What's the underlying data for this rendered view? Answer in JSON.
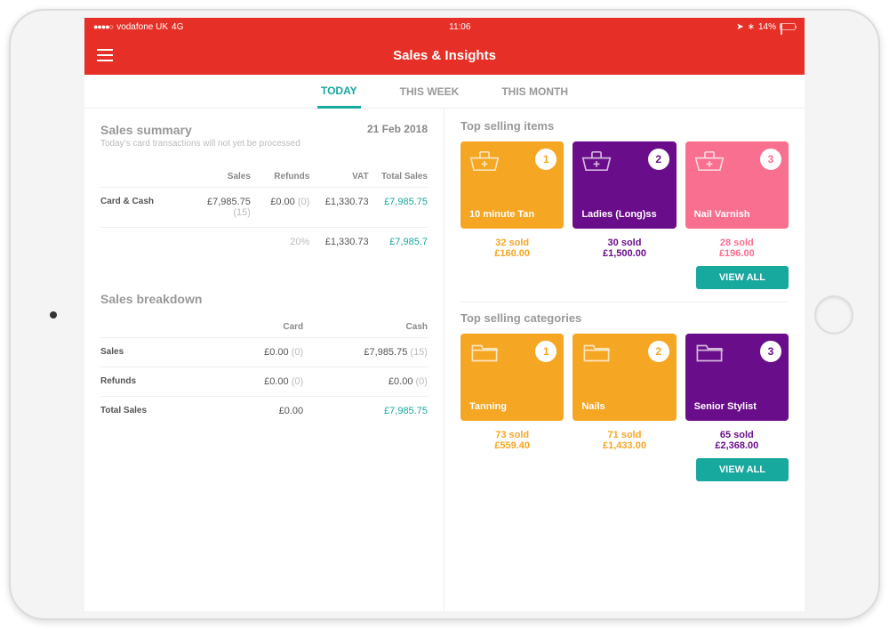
{
  "status": {
    "carrier": "vodafone UK",
    "network": "4G",
    "time": "11:06",
    "bluetooth": "∗",
    "battery": "14%"
  },
  "nav": {
    "title": "Sales & Insights"
  },
  "tabs": {
    "today": "TODAY",
    "week": "THIS WEEK",
    "month": "THIS MONTH"
  },
  "summary": {
    "title": "Sales summary",
    "date": "21 Feb 2018",
    "subtitle": "Today's card transactions will not yet be processed",
    "headers": {
      "sales": "Sales",
      "refunds": "Refunds",
      "vat": "VAT",
      "total": "Total Sales"
    },
    "row": {
      "label": "Card & Cash",
      "sales": "£7,985.75",
      "sales_count": "(15)",
      "refunds": "£0.00",
      "refunds_count": "(0)",
      "vat": "£1,330.73",
      "total": "£7,985.75"
    },
    "footer": {
      "pct": "20%",
      "vat": "£1,330.73",
      "total": "£7,985.7"
    }
  },
  "breakdown": {
    "title": "Sales breakdown",
    "headers": {
      "card": "Card",
      "cash": "Cash"
    },
    "rows": [
      {
        "label": "Sales",
        "card": "£0.00",
        "card_count": "(0)",
        "cash": "£7,985.75",
        "cash_count": "(15)"
      },
      {
        "label": "Refunds",
        "card": "£0.00",
        "card_count": "(0)",
        "cash": "£0.00",
        "cash_count": "(0)"
      },
      {
        "label": "Total Sales",
        "card": "£0.00",
        "card_count": "",
        "cash": "£7,985.75",
        "cash_count": "",
        "cash_teal": true
      }
    ]
  },
  "topItems": {
    "title": "Top selling items",
    "cards": [
      {
        "rank": "1",
        "name": "10 minute Tan",
        "sold": "32 sold",
        "amount": "£160.00",
        "color": "orange"
      },
      {
        "rank": "2",
        "name": "Ladies (Long)ss",
        "sold": "30 sold",
        "amount": "£1,500.00",
        "color": "purple"
      },
      {
        "rank": "3",
        "name": "Nail Varnish",
        "sold": "28 sold",
        "amount": "£196.00",
        "color": "pink"
      }
    ],
    "viewAll": "VIEW ALL"
  },
  "topCategories": {
    "title": "Top selling categories",
    "cards": [
      {
        "rank": "1",
        "name": "Tanning",
        "sold": "73 sold",
        "amount": "£559.40",
        "color": "orange"
      },
      {
        "rank": "2",
        "name": "Nails",
        "sold": "71 sold",
        "amount": "£1,433.00",
        "color": "orange"
      },
      {
        "rank": "3",
        "name": "Senior Stylist",
        "sold": "65 sold",
        "amount": "£2,368.00",
        "color": "purple"
      }
    ],
    "viewAll": "VIEW ALL"
  },
  "colors": {
    "orange": "#f5a623",
    "purple": "#6a0d8a",
    "pink": "#f96f8f"
  }
}
